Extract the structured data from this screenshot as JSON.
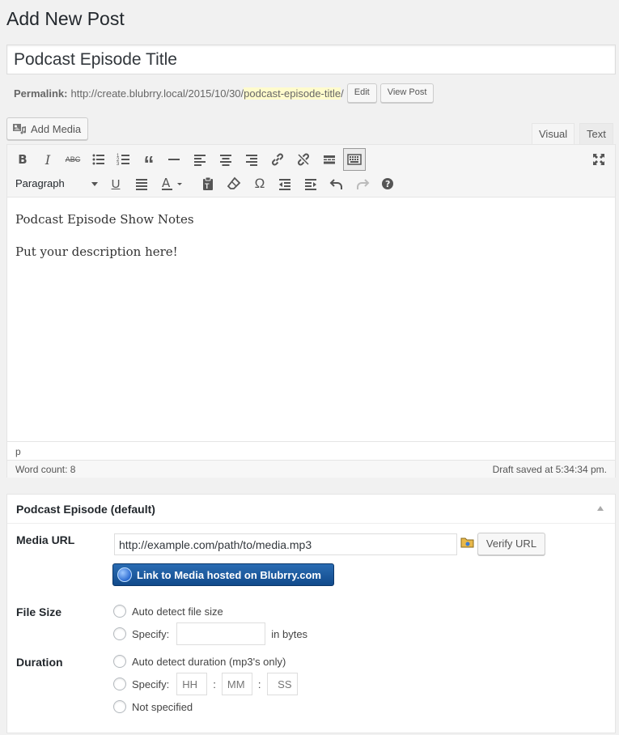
{
  "page": {
    "title": "Add New Post"
  },
  "post": {
    "title": "Podcast Episode Title",
    "permalink_label": "Permalink:",
    "permalink_base": "http://create.blubrry.local/2015/10/30/",
    "permalink_slug": "podcast-episode-title",
    "permalink_end": "/",
    "edit_label": "Edit",
    "view_label": "View Post"
  },
  "media": {
    "add_label": "Add Media"
  },
  "editor": {
    "tab_visual": "Visual",
    "tab_text": "Text",
    "format_value": "Paragraph",
    "icons_row1": [
      "bold-icon",
      "italic-icon",
      "strikethrough-icon",
      "bullet-list-icon",
      "numbered-list-icon",
      "blockquote-icon",
      "horizontal-line-icon",
      "align-left-icon",
      "align-center-icon",
      "align-right-icon",
      "link-icon",
      "unlink-icon",
      "read-more-icon",
      "toolbar-toggle-icon",
      "fullscreen-icon"
    ],
    "icons_row2": [
      "underline-icon",
      "justify-icon",
      "text-color-icon",
      "paste-text-icon",
      "clear-format-icon",
      "special-char-icon",
      "outdent-icon",
      "indent-icon",
      "undo-icon",
      "redo-icon",
      "help-icon"
    ],
    "content": {
      "line1": "Podcast Episode Show Notes",
      "line2": "Put your description here!"
    },
    "path": "p",
    "word_count": "Word count: 8",
    "draft_saved": "Draft saved at 5:34:34 pm."
  },
  "podcast": {
    "box_title": "Podcast Episode (default)",
    "media_url_label": "Media URL",
    "media_url_value": "http://example.com/path/to/media.mp3",
    "verify_label": "Verify URL",
    "blubrry_label": "Link to Media hosted on Blubrry.com",
    "file_size_label": "File Size",
    "file_size_auto": "Auto detect file size",
    "file_size_specify": "Specify:",
    "file_size_unit": "in bytes",
    "duration_label": "Duration",
    "duration_auto": "Auto detect duration (mp3's only)",
    "duration_specify": "Specify:",
    "hh_placeholder": "HH",
    "mm_placeholder": "MM",
    "ss_placeholder": "SS",
    "time_sep": ":",
    "not_specified": "Not specified"
  },
  "colors": {
    "slug_highlight": "#fffbcc",
    "blubrry_blue": "#1a5aa2"
  }
}
